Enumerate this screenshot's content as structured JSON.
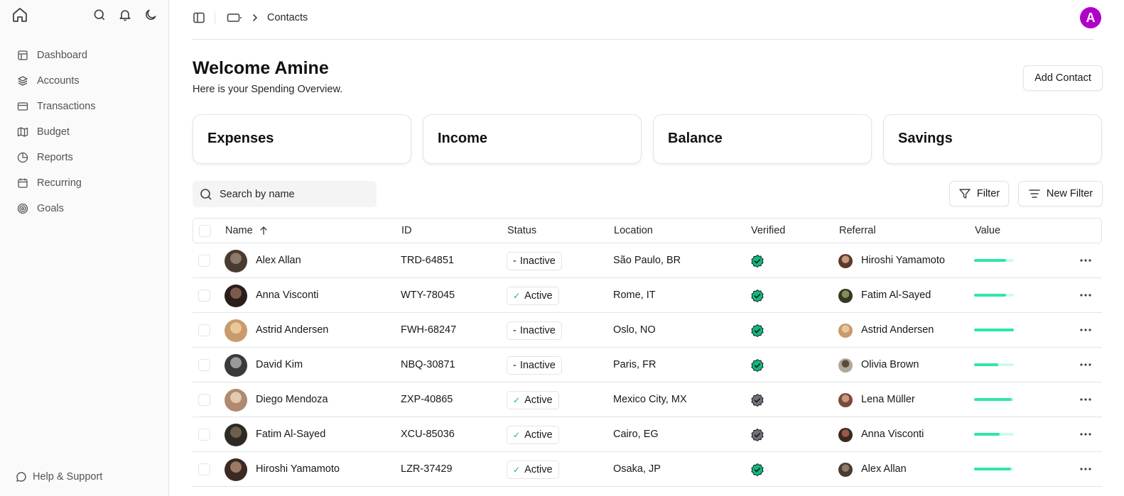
{
  "sidebar": {
    "items": [
      {
        "label": "Dashboard",
        "icon": "dashboard-icon"
      },
      {
        "label": "Accounts",
        "icon": "layers-icon"
      },
      {
        "label": "Transactions",
        "icon": "card-icon"
      },
      {
        "label": "Budget",
        "icon": "map-icon"
      },
      {
        "label": "Reports",
        "icon": "pie-chart-icon"
      },
      {
        "label": "Recurring",
        "icon": "calendar-icon"
      },
      {
        "label": "Goals",
        "icon": "target-icon"
      }
    ],
    "help_label": "Help & Support"
  },
  "topbar": {
    "breadcrumb": "Contacts",
    "avatar_initial": "A",
    "avatar_color": "#b100c9"
  },
  "header": {
    "title": "Welcome Amine",
    "subtitle": "Here is your Spending Overview.",
    "add_contact_label": "Add Contact"
  },
  "cards": [
    "Expenses",
    "Income",
    "Balance",
    "Savings"
  ],
  "search": {
    "placeholder": "Search by name"
  },
  "filters": {
    "filter_label": "Filter",
    "new_filter_label": "New Filter"
  },
  "table": {
    "columns": [
      "Name",
      "ID",
      "Status",
      "Location",
      "Verified",
      "Referral",
      "Value"
    ],
    "rows": [
      {
        "name": "Alex Allan",
        "id": "TRD-64851",
        "status": "Inactive",
        "location": "São Paulo, BR",
        "verified": true,
        "referral": "Hiroshi Yamamoto",
        "value": 0.8
      },
      {
        "name": "Anna Visconti",
        "id": "WTY-78045",
        "status": "Active",
        "location": "Rome, IT",
        "verified": true,
        "referral": "Fatim Al-Sayed",
        "value": 0.8
      },
      {
        "name": "Astrid Andersen",
        "id": "FWH-68247",
        "status": "Inactive",
        "location": "Oslo, NO",
        "verified": true,
        "referral": "Astrid Andersen",
        "value": 1.0
      },
      {
        "name": "David Kim",
        "id": "NBQ-30871",
        "status": "Inactive",
        "location": "Paris, FR",
        "verified": true,
        "referral": "Olivia Brown",
        "value": 0.6
      },
      {
        "name": "Diego Mendoza",
        "id": "ZXP-40865",
        "status": "Active",
        "location": "Mexico City, MX",
        "verified": false,
        "referral": "Lena Müller",
        "value": 0.95
      },
      {
        "name": "Fatim Al-Sayed",
        "id": "XCU-85036",
        "status": "Active",
        "location": "Cairo, EG",
        "verified": false,
        "referral": "Anna Visconti",
        "value": 0.65
      },
      {
        "name": "Hiroshi Yamamoto",
        "id": "LZR-37429",
        "status": "Active",
        "location": "Osaka, JP",
        "verified": true,
        "referral": "Alex Allan",
        "value": 0.92
      }
    ]
  },
  "colors": {
    "accent_green": "#2ee6a8",
    "verified_green": "#10b981",
    "verified_gray": "#71717a"
  }
}
